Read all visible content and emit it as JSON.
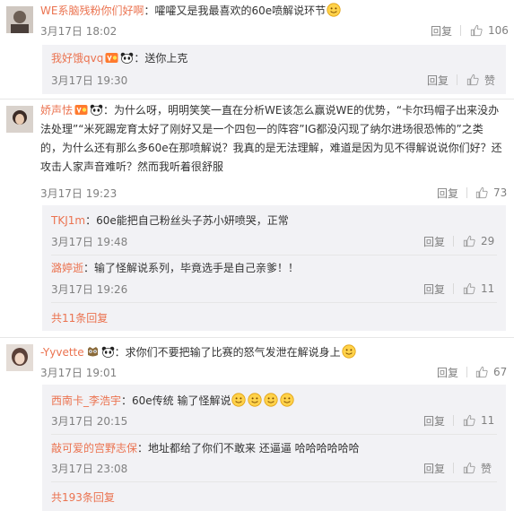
{
  "comments": [
    {
      "user": "WE系脑残粉你们好啊",
      "text": "：嚯嚯又是我最喜欢的60e喷解说环节",
      "time": "3月17日 18:02",
      "reply_label": "回复",
      "likes": "106",
      "replies": [
        {
          "user": "我好饿qvq",
          "text": "：送你上克",
          "time": "3月17日 19:30",
          "reply_label": "回复",
          "likes": "赞"
        }
      ]
    },
    {
      "user": "娇声怯",
      "text_line1": "：为什么呀，明明笑笑一直在分析WE该怎么赢说WE的优势，“卡尔玛帽子出来没办",
      "text_line2": "法处理”“米死踢宠育太好了刚好又是一个四包一的阵容”IG都没闪现了纳尔进场很恐怖的”之类",
      "text_line3": "的，为什么还有那么多60e在那喷解说？我真的是无法理解，难道是因为见不得解说说你们好？还",
      "text_line4": "攻击人家声音难听？然而我听着很舒服",
      "time": "3月17日 19:23",
      "reply_label": "回复",
      "likes": "73",
      "replies": [
        {
          "user": "TKJ1m",
          "text": "：60e能把自己粉丝头子苏小妍喷哭，正常",
          "time": "3月17日 19:48",
          "reply_label": "回复",
          "likes": "29"
        },
        {
          "user": "潞婷逝",
          "text": "：输了怪解说系列，毕竟选手是自己亲爹！！",
          "time": "3月17日 19:26",
          "reply_label": "回复",
          "likes": "11"
        }
      ],
      "more_label": "共11条回复"
    },
    {
      "user": "-Yyvette",
      "text": "：求你们不要把输了比赛的怒气发泄在解说身上",
      "time": "3月17日 19:01",
      "reply_label": "回复",
      "likes": "67",
      "replies": [
        {
          "user": "西南卡_李浩宇",
          "text": "：60e传统 输了怪解说",
          "time": "3月17日 20:15",
          "reply_label": "回复",
          "likes": "11"
        },
        {
          "user": "敲可爱的宫野志保",
          "text": "：地址都给了你们不敢来 还逼逼 哈哈哈哈哈哈",
          "time": "3月17日 23:08",
          "reply_label": "回复",
          "likes": "赞"
        }
      ],
      "more_label": "共193条回复"
    }
  ],
  "colors": {
    "username": "#eb7350",
    "meta": "#808080",
    "reply_box": "#f2f2f5"
  }
}
